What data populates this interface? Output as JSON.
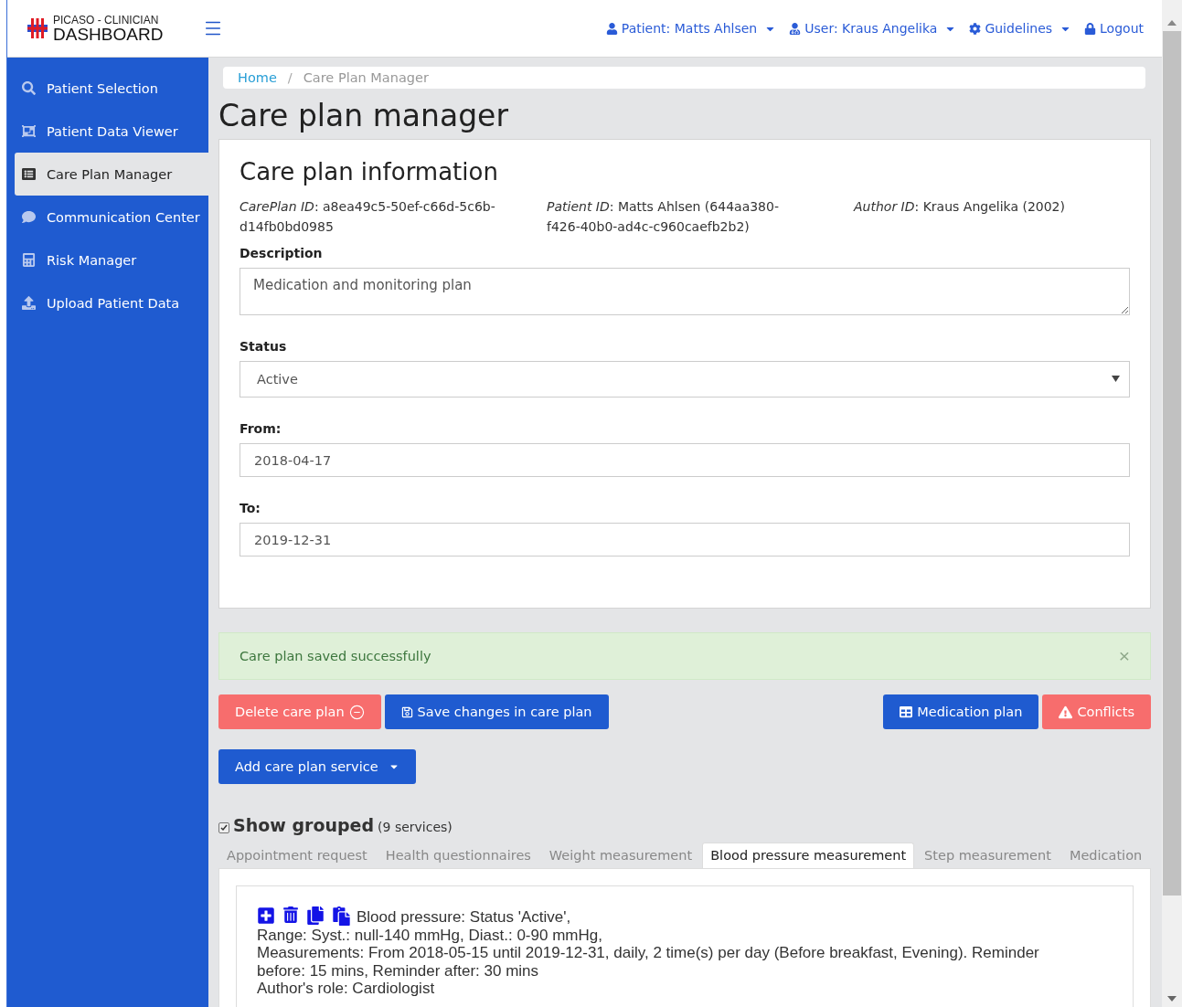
{
  "brand": {
    "top": "PICASO - CLINICIAN",
    "main": "DASHBOARD"
  },
  "topnav": [
    {
      "kind": "patient",
      "label": "Patient: Matts Ahlsen",
      "dropdown": true
    },
    {
      "kind": "user",
      "label": "User: Kraus Angelika",
      "dropdown": true
    },
    {
      "kind": "guidelines",
      "label": "Guidelines",
      "dropdown": true
    },
    {
      "kind": "logout",
      "label": "Logout",
      "dropdown": false
    }
  ],
  "sidebar": {
    "items": [
      {
        "kind": "search",
        "label": "Patient Selection",
        "selected": false
      },
      {
        "kind": "viewer",
        "label": "Patient Data Viewer",
        "selected": false
      },
      {
        "kind": "list",
        "label": "Care Plan Manager",
        "selected": true
      },
      {
        "kind": "chat",
        "label": "Communication Center",
        "selected": false
      },
      {
        "kind": "calc",
        "label": "Risk Manager",
        "selected": false
      },
      {
        "kind": "upload",
        "label": "Upload Patient Data",
        "selected": false
      }
    ]
  },
  "breadcrumb": [
    {
      "label": "Home",
      "link": true
    },
    {
      "label": "Care Plan Manager",
      "link": false
    }
  ],
  "breadcrumb_separator": "/",
  "page_title": "Care plan manager",
  "card": {
    "title": "Care plan information",
    "info": [
      "*CarePlan ID*: a8ea49c5-50ef-c66d-5c6b-d14fb0bd0985",
      "*Patient ID*: Matts Ahlsen (644aa380-f426-40b0-ad4c-c960caefb2b2)",
      "*Author ID*: Kraus Angelika (2002)"
    ],
    "fields": [
      {
        "kind": "textarea",
        "label": "Description",
        "value": "Medication and monitoring plan"
      },
      {
        "kind": "select",
        "label": "Status",
        "value": "Active"
      },
      {
        "kind": "input",
        "label": "From:",
        "value": "2018-04-17"
      },
      {
        "kind": "input",
        "label": "To:",
        "value": "2019-12-31"
      }
    ]
  },
  "alert": {
    "text": "Care plan saved successfully",
    "close": "×"
  },
  "actions": [
    {
      "kind": "delete",
      "label": "Delete care plan"
    },
    {
      "kind": "save",
      "label": "Save changes in care plan"
    },
    {
      "kind": "medication",
      "label": "Medication plan"
    },
    {
      "kind": "conflicts",
      "label": "Conflicts"
    }
  ],
  "add_service": {
    "label": "Add care plan service"
  },
  "grouping": {
    "label": "Show grouped",
    "count": "(9 services)",
    "checked": true
  },
  "tabs": [
    {
      "label": "Appointment request",
      "selected": false
    },
    {
      "label": "Health questionnaires",
      "selected": false
    },
    {
      "label": "Weight measurement",
      "selected": false
    },
    {
      "label": "Blood pressure measurement",
      "selected": true
    },
    {
      "label": "Step measurement",
      "selected": false
    },
    {
      "label": "Medication",
      "selected": false
    }
  ],
  "service": {
    "lines": [
      "Blood pressure: Status 'Active',",
      "Range: Syst.: null-140 mmHg, Diast.: 0-90 mmHg,",
      "Measurements: From 2018-05-15 until 2019-12-31, daily, 2 time(s) per day (Before breakfast, Evening). Reminder before: 15 mins, Reminder after: 30 mins",
      "Author's role: Cardiologist"
    ]
  }
}
